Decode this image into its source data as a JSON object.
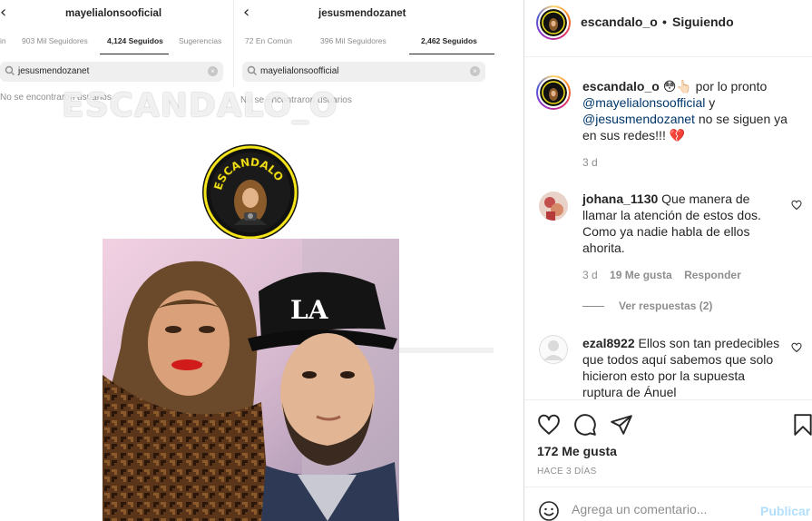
{
  "post_image": {
    "left_screenshot": {
      "title": "mayelialonsooficial",
      "tabs": [
        "in",
        "903 Mil Seguidores",
        "4,124 Seguidos",
        "Sugerencias"
      ],
      "search_value": "jesusmendozanet",
      "no_results": "No se encontraron usuarios"
    },
    "right_screenshot": {
      "title": "jesusmendozanet",
      "tabs": [
        "72 En Común",
        "396 Mil Seguidores",
        "2,462 Seguidos"
      ],
      "search_value": "mayelialonsoofficial",
      "no_results": "No se encontraron usuarios"
    },
    "watermark": "ESCANDALO_O",
    "logo_text": "ESCANDALO"
  },
  "header": {
    "username": "escandalo_o",
    "dot": "•",
    "follow_status": "Siguiendo"
  },
  "caption": {
    "username": "escandalo_o",
    "emojis": "😳👆🏻",
    "text_1": " por lo pronto",
    "mention_1": "@mayelialonsoofficial",
    "text_2": " y",
    "mention_2": "@jesusmendozanet",
    "text_3": " no se siguen ya en sus redes!!! 💔",
    "time": "3 d"
  },
  "comments": [
    {
      "username": "johana_1130",
      "text": "Que manera de llamar la atención de estos dos. Como ya nadie habla de ellos ahorita.",
      "time": "3 d",
      "likes": "19 Me gusta",
      "reply": "Responder",
      "view_replies": "Ver respuestas (2)"
    },
    {
      "username": "ezal8922",
      "text": "Ellos son tan predecibles que todos aquí sabemos que solo hicieron esto por la supuesta ruptura de Ánuel"
    }
  ],
  "actions": {
    "likes": "172 Me gusta",
    "date": "HACE 3 DÍAS"
  },
  "add_comment": {
    "placeholder": "Agrega un comentario...",
    "publish": "Publicar"
  }
}
